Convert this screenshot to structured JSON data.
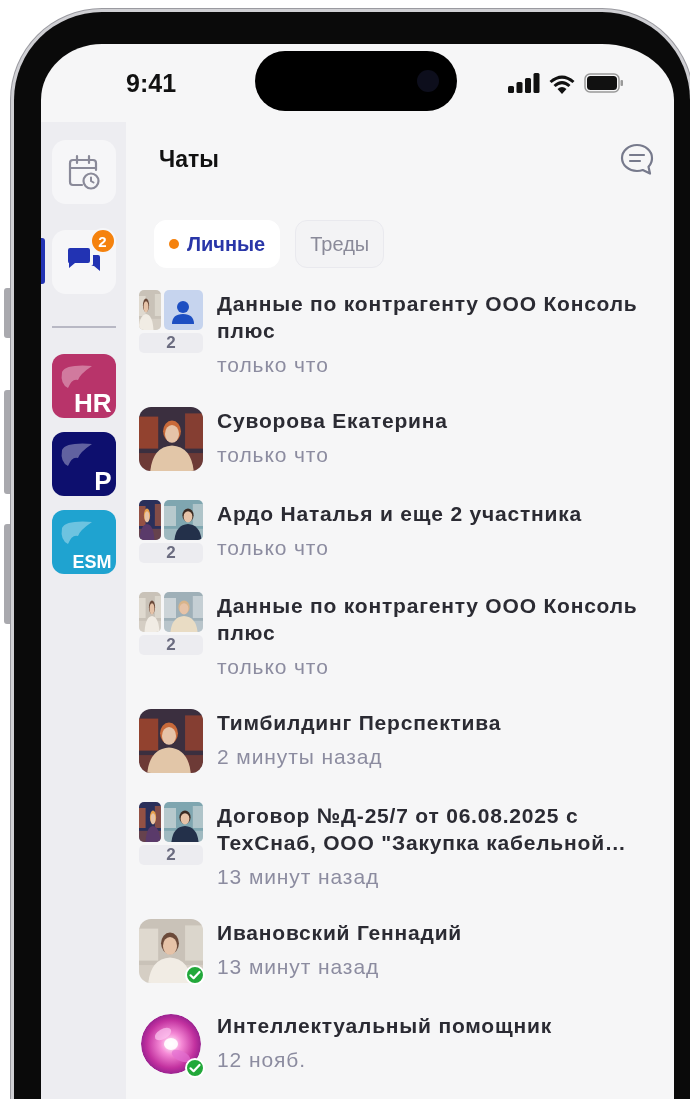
{
  "status_bar": {
    "time": "9:41"
  },
  "sidebar": {
    "items": [
      {
        "kind": "calendar",
        "selected": false
      },
      {
        "kind": "chats",
        "selected": true,
        "badge": "2"
      }
    ],
    "apps": [
      {
        "label": "HR",
        "color": "#b8346a"
      },
      {
        "label": "P",
        "color": "#0d0f6e"
      },
      {
        "label": "ESM",
        "color": "#1fa3d0"
      }
    ]
  },
  "header": {
    "title": "Чаты"
  },
  "tabs": [
    {
      "label": "Личные",
      "selected": true,
      "unread": true
    },
    {
      "label": "Треды",
      "selected": false,
      "unread": false
    }
  ],
  "chats": [
    {
      "title": "Данные по контрагенту ООО Консоль плюс",
      "time": "только что",
      "avatar": {
        "kind": "group",
        "members": [
          {
            "kind": "picture"
          },
          {
            "kind": "placeholder"
          }
        ],
        "count": "2"
      },
      "online": false
    },
    {
      "title": "Суворова Екатерина",
      "time": "только что",
      "avatar": {
        "kind": "picture"
      },
      "online": false
    },
    {
      "title": "Ардо Наталья и еще 2 участника",
      "time": "только что",
      "avatar": {
        "kind": "group",
        "members": [
          {
            "kind": "picture"
          },
          {
            "kind": "picture"
          }
        ],
        "count": "2"
      },
      "online": false
    },
    {
      "title": "Данные по контрагенту ООО Консоль плюс",
      "time": "только что",
      "avatar": {
        "kind": "group",
        "members": [
          {
            "kind": "picture"
          },
          {
            "kind": "picture"
          }
        ],
        "count": "2"
      },
      "online": false
    },
    {
      "title": "Тимбилдинг Перспектива",
      "time": "2 минуты назад",
      "avatar": {
        "kind": "picture"
      },
      "online": false
    },
    {
      "title": "Договор №Д-25/7 от 06.08.2025 с ТехСнаб, ООО \"Закупка кабельной…",
      "time": "13 минут назад",
      "avatar": {
        "kind": "group",
        "members": [
          {
            "kind": "picture"
          },
          {
            "kind": "picture"
          }
        ],
        "count": "2"
      },
      "online": false
    },
    {
      "title": "Ивановский Геннадий",
      "time": "13 минут назад",
      "avatar": {
        "kind": "picture"
      },
      "online": true
    },
    {
      "title": "Интеллектуальный помощник",
      "time": "12 нояб.",
      "avatar": {
        "kind": "orb"
      },
      "online": true
    }
  ]
}
